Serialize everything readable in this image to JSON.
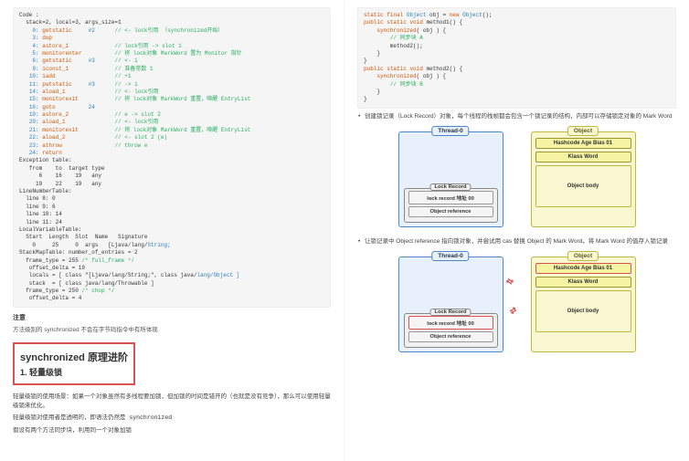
{
  "left": {
    "code_header": "Code :",
    "stack_line": "  stack=2, local=3, args_size=1",
    "bytecode": [
      {
        "n": "0:",
        "i": "getstatic",
        "a": "#2",
        "c": "// <- lock引用 （synchronized开始）"
      },
      {
        "n": "3:",
        "i": "dup",
        "a": "",
        "c": ""
      },
      {
        "n": "4:",
        "i": "astore_1",
        "a": "",
        "c": "// lock引用 -> slot 1"
      },
      {
        "n": "5:",
        "i": "monitorenter",
        "a": "",
        "c": "// 将 lock对象 MarkWord 置为 Monitor 指针"
      },
      {
        "n": "6:",
        "i": "getstatic",
        "a": "#3",
        "c": "// <- i"
      },
      {
        "n": "9:",
        "i": "iconst_1",
        "a": "",
        "c": "// 准备常数 1"
      },
      {
        "n": "10:",
        "i": "iadd",
        "a": "",
        "c": "// +1"
      },
      {
        "n": "11:",
        "i": "putstatic",
        "a": "#3",
        "c": "// -> i"
      },
      {
        "n": "14:",
        "i": "aload_1",
        "a": "",
        "c": "// <- lock引用"
      },
      {
        "n": "15:",
        "i": "monitorexit",
        "a": "",
        "c": "// 将 lock对象 MarkWord 重置，唤醒 EntryList"
      },
      {
        "n": "16:",
        "i": "goto",
        "a": "24",
        "c": ""
      },
      {
        "n": "19:",
        "i": "astore_2",
        "a": "",
        "c": "// e -> slot 2"
      },
      {
        "n": "20:",
        "i": "aload_1",
        "a": "",
        "c": "// <- lock引用"
      },
      {
        "n": "21:",
        "i": "monitorexit",
        "a": "",
        "c": "// 将 lock对象 MarkWord 重置，唤醒 EntryList"
      },
      {
        "n": "22:",
        "i": "aload_2",
        "a": "",
        "c": "// <- slot 2 (e)"
      },
      {
        "n": "23:",
        "i": "athrow",
        "a": "",
        "c": "// throw e"
      },
      {
        "n": "24:",
        "i": "return",
        "a": "",
        "c": ""
      }
    ],
    "exc_header": "Exception table:",
    "exc_cols": "   from    to  target type",
    "exc_rows": [
      "      6    16    19   any",
      "     19    22    19   any"
    ],
    "lnt_header": "LineNumberTable:",
    "lnt_rows": [
      "  line 8: 0",
      "  line 9: 6",
      "  line 10: 14",
      "  line 11: 24"
    ],
    "lvt_header": "LocalVariableTable:",
    "lvt_cols": "  Start  Length  Slot  Name   Signature",
    "lvt_row": "    0     25     0  args   [Ljava/lang/",
    "lvt_row_type": "String;",
    "smt_header": "StackMapTable: number_of_entries = 2",
    "smt1": "  frame_type = 255 ",
    "smt1c": "/* full_frame */",
    "smt_off1": "   offset_delta = 19",
    "smt_locals": "   locals = [ class \"[Ljava/lang/String;\", class java/",
    "smt_locals_type": "lang/Object ]",
    "smt_stack": "   stack  = [ class java/lang/Throwable ]",
    "smt2": "  frame_type = 250 ",
    "smt2c": "/* chop */",
    "smt_off2": "   offset_delta = 4",
    "note_title": "注意",
    "note_text": "方法级别的 synchronized 不会在字节码指令中有所体现",
    "h2": "synchronized 原理进阶",
    "h3": "1. 轻量级锁",
    "p1": "轻量级锁的使用场景：如果一个对象虽然有多线程要加锁，但加锁的时间是错开的（也就是没有竞争），那么可以使用轻量级锁来优化。",
    "p2_a": "轻量级锁对使用者是透明的，即语法仍然是 ",
    "p2_code": "synchronized",
    "p3": "假设有两个方法同步块，利用同一个对象加锁"
  },
  "right": {
    "code": [
      "static final Object obj = new Object();",
      "public static void method1() {",
      "    synchronized( obj ) {",
      "        // 同步块 A",
      "        method2();",
      "    }",
      "}",
      "public static void method2() {",
      "    synchronized( obj ) {",
      "        // 同步块 B",
      "    }",
      "}"
    ],
    "bullet1": "创建锁记录（Lock Record）对象，每个线程的栈帧都会包含一个锁记录的结构，内部可以存储锁定对象的 Mark Word",
    "bullet2": "让锁记录中 Object reference 指向锁对象，并尝试用 cas 替换 Object 的 Mark Word，将 Mark Word 的值存入锁记录",
    "t_thread": "Thread-0",
    "t_object": "Object",
    "cell_hash": "Hashcode Age Bias 01",
    "cell_klass": "Klass Word",
    "cell_body": "Object body",
    "t_lockrec": "Lock Record",
    "cell_lraddr": "lock record 地址 00",
    "cell_objref": "Object reference"
  }
}
